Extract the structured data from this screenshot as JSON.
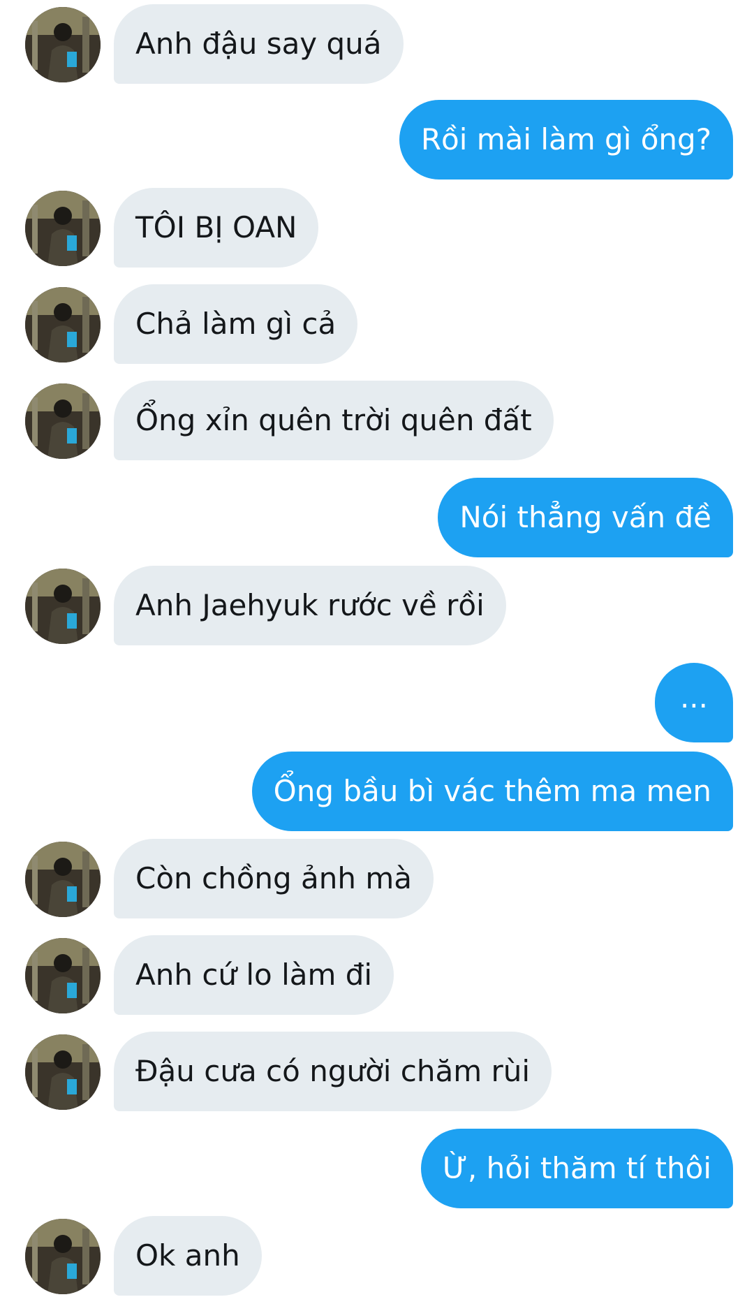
{
  "conversation": {
    "messages": [
      {
        "dir": "in",
        "text": "Anh đậu say quá"
      },
      {
        "dir": "out",
        "text": "Rồi mài làm gì ổng?"
      },
      {
        "dir": "in",
        "text": "TÔI BỊ OAN"
      },
      {
        "dir": "in",
        "text": "Chả làm gì cả"
      },
      {
        "dir": "in",
        "text": "Ổng xỉn quên trời quên đất"
      },
      {
        "dir": "out",
        "text": "Nói thẳng vấn đề"
      },
      {
        "dir": "in",
        "text": "Anh Jaehyuk rước về rồi"
      },
      {
        "dir": "out",
        "text": "..."
      },
      {
        "dir": "out",
        "text": "Ổng bầu bì vác thêm ma men"
      },
      {
        "dir": "in",
        "text": "Còn chồng ảnh mà"
      },
      {
        "dir": "in",
        "text": "Anh cứ lo làm đi"
      },
      {
        "dir": "in",
        "text": "Đậu cưa có người chăm rùi"
      },
      {
        "dir": "out",
        "text": "Ừ, hỏi thăm tí thôi"
      },
      {
        "dir": "in",
        "text": "Ok anh"
      }
    ]
  },
  "colors": {
    "incoming_bubble": "#e6ecf0",
    "outgoing_bubble": "#1da1f2",
    "incoming_text": "#14171a",
    "outgoing_text": "#ffffff"
  },
  "icons": {
    "avatar": "contact-avatar-photo"
  }
}
